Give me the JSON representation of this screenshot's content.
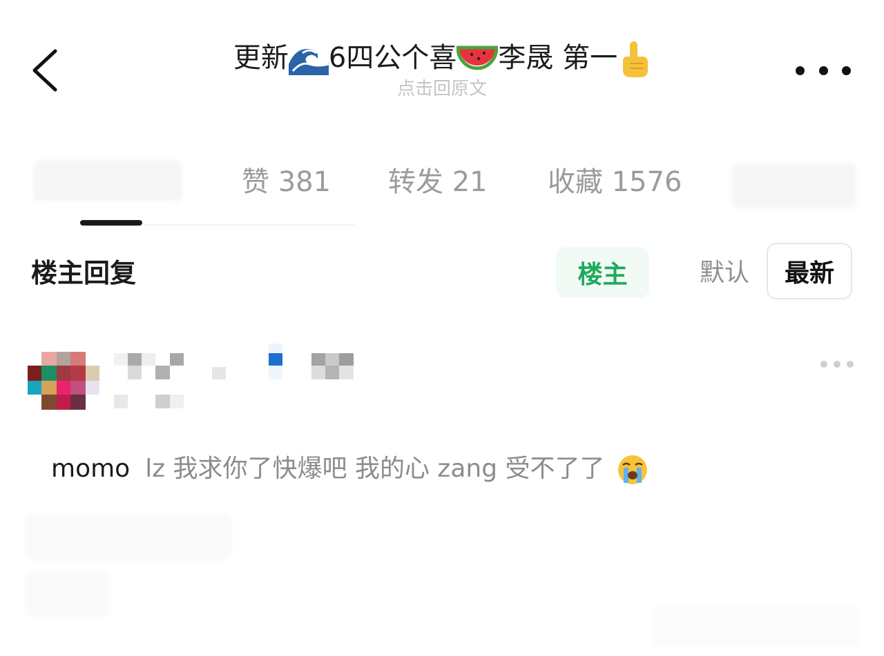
{
  "header": {
    "title_part1": "更新",
    "title_part2": "6四公个喜",
    "title_part3": "李晟 第一",
    "subtitle": "点击回原文",
    "icons": [
      "back-arrow-icon",
      "wave-icon",
      "watermelon-icon",
      "index-pointing-up-icon",
      "more-horizontal-icon"
    ]
  },
  "tabs": [
    {
      "label": "赞 381"
    },
    {
      "label": "转发 21"
    },
    {
      "label": "收藏 1576"
    }
  ],
  "filter": {
    "section_title": "楼主回复",
    "owner_chip": "楼主",
    "sort_default": "默认",
    "sort_latest": "最新"
  },
  "comment": {
    "user": "momo",
    "body": "lz 我求你了快爆吧 我的心 zang 受不了了",
    "emoji": "crying-face-icon"
  },
  "colors": {
    "accent_green": "#1eaa5c",
    "muted_text": "#8c8c8c",
    "subtitle_gray": "#c4c4c4"
  }
}
